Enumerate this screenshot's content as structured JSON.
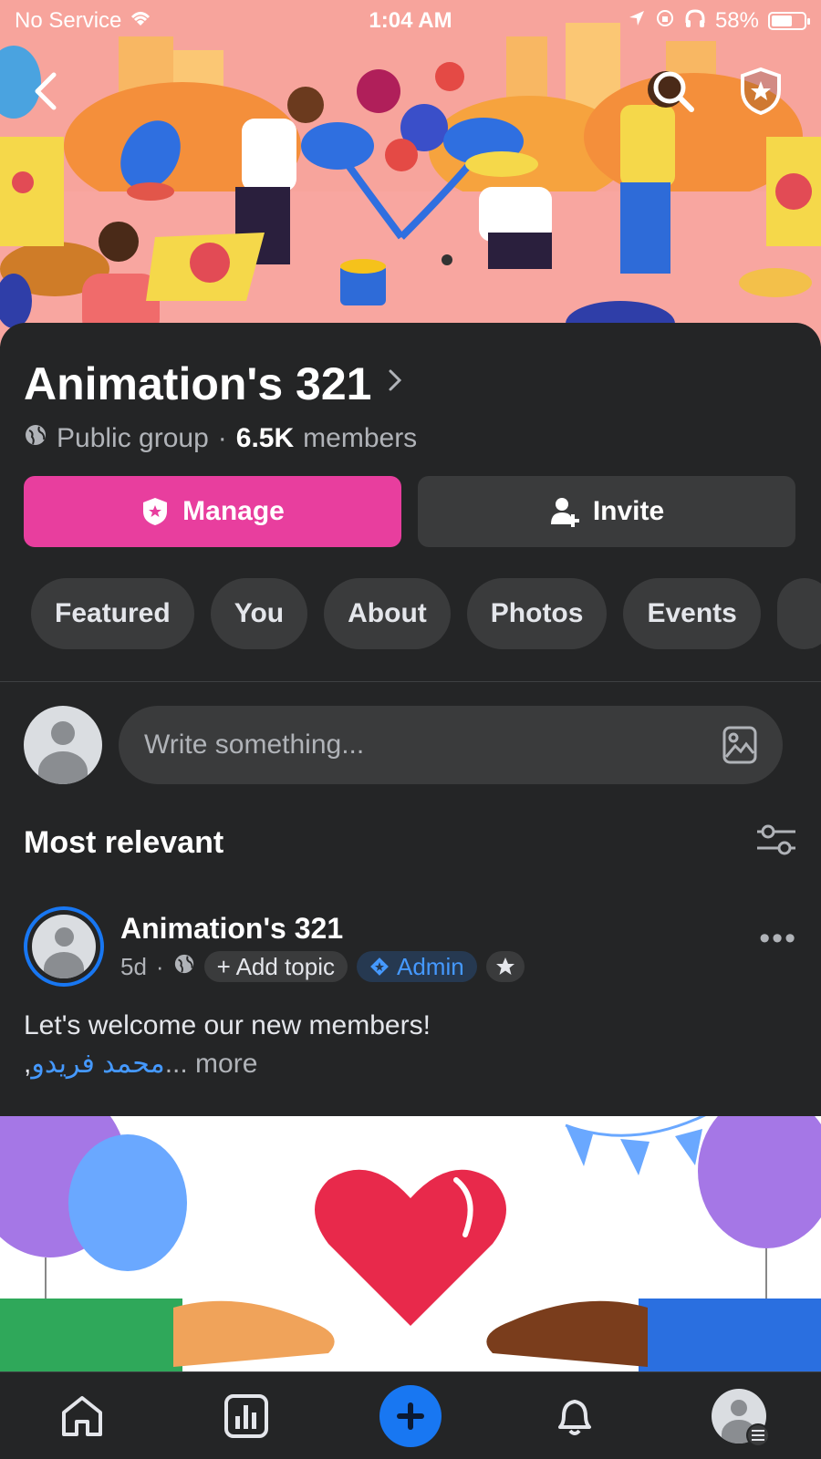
{
  "status_bar": {
    "carrier": "No Service",
    "time": "1:04 AM",
    "battery": "58%"
  },
  "group": {
    "name": "Animation's 321",
    "privacy": "Public group",
    "separator": "·",
    "members_count": "6.5K",
    "members_label": "members"
  },
  "actions": {
    "manage": "Manage",
    "invite": "Invite"
  },
  "tabs": [
    "Featured",
    "You",
    "About",
    "Photos",
    "Events"
  ],
  "composer": {
    "placeholder": "Write something..."
  },
  "feed": {
    "sort_label": "Most relevant"
  },
  "post": {
    "author": "Animation's 321",
    "age": "5d",
    "dot": "·",
    "add_topic": "+ Add topic",
    "badge": "Admin",
    "more_menu": "•••",
    "text": "Let's welcome our new members!",
    "mention": "محمد فريدو",
    "mention_suffix": ",",
    "ellipsis": "...",
    "more_link": "more"
  },
  "colors": {
    "manage_pink": "#e83e9e",
    "brand_blue": "#1877f2",
    "background": "#242526",
    "surface": "#3a3b3c"
  }
}
